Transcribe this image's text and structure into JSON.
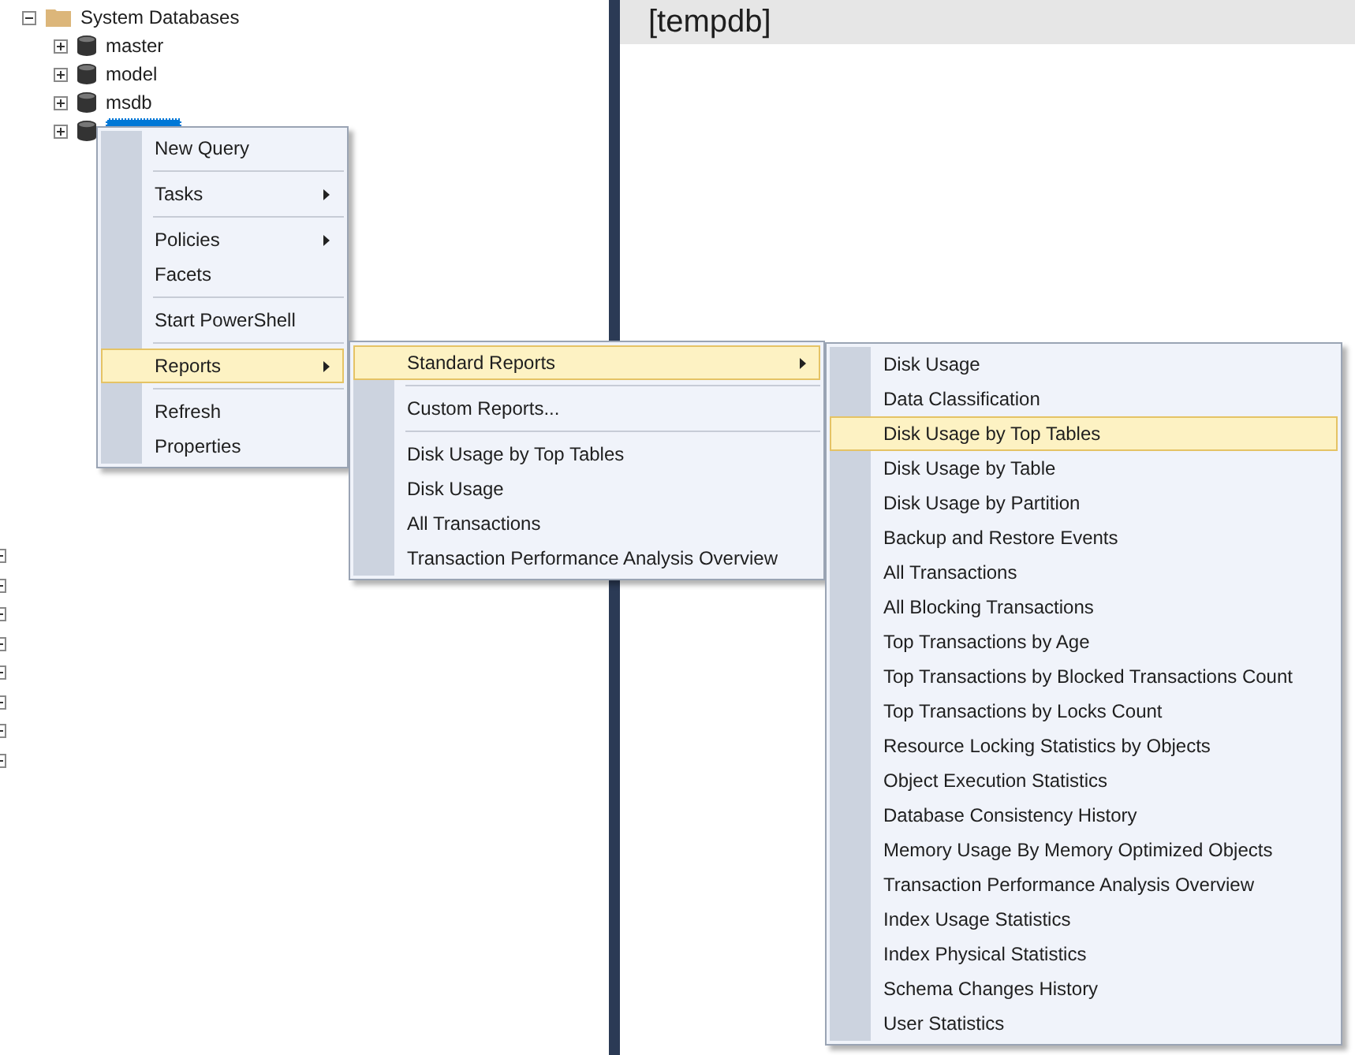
{
  "object_explorer": {
    "tree": {
      "label": "System Databases",
      "expanded": true,
      "children": [
        {
          "label": "master",
          "expanded": false,
          "selected": false
        },
        {
          "label": "model",
          "expanded": false,
          "selected": false
        },
        {
          "label": "msdb",
          "expanded": false,
          "selected": false
        },
        {
          "expanded": false,
          "selected": true
        }
      ]
    },
    "cut_off_rows": [
      {
        "kind": "expander"
      },
      {
        "kind": "expander"
      },
      {
        "kind": "expander"
      },
      {
        "kind": "expander"
      },
      {
        "kind": "expander"
      },
      {
        "kind": "expander"
      },
      {
        "kind": "expander"
      },
      {
        "kind": "expander"
      }
    ]
  },
  "document": {
    "title": "[tempdb]"
  },
  "context_menu": [
    {
      "kind": "item",
      "label": "New Query",
      "submenu": false,
      "selected": false
    },
    {
      "kind": "separator"
    },
    {
      "kind": "item",
      "label": "Tasks",
      "submenu": true,
      "selected": false
    },
    {
      "kind": "separator"
    },
    {
      "kind": "item",
      "label": "Policies",
      "submenu": true,
      "selected": false
    },
    {
      "kind": "item",
      "label": "Facets",
      "submenu": false,
      "selected": false
    },
    {
      "kind": "separator"
    },
    {
      "kind": "item",
      "label": "Start PowerShell",
      "submenu": false,
      "selected": false
    },
    {
      "kind": "separator"
    },
    {
      "kind": "item",
      "label": "Reports",
      "submenu": true,
      "selected": true
    },
    {
      "kind": "separator"
    },
    {
      "kind": "item",
      "label": "Refresh",
      "submenu": false,
      "selected": false
    },
    {
      "kind": "item",
      "label": "Properties",
      "submenu": false,
      "selected": false
    }
  ],
  "reports_menu": [
    {
      "kind": "item",
      "label": "Standard Reports",
      "submenu": true,
      "selected": true
    },
    {
      "kind": "separator"
    },
    {
      "kind": "item",
      "label": "Custom Reports...",
      "submenu": false,
      "selected": false
    },
    {
      "kind": "separator"
    },
    {
      "kind": "item",
      "label": "Disk Usage by Top Tables",
      "submenu": false,
      "selected": false
    },
    {
      "kind": "item",
      "label": "Disk Usage",
      "submenu": false,
      "selected": false
    },
    {
      "kind": "item",
      "label": "All Transactions",
      "submenu": false,
      "selected": false
    },
    {
      "kind": "item",
      "label": "Transaction Performance Analysis Overview",
      "submenu": false,
      "selected": false
    }
  ],
  "standard_reports_menu": [
    {
      "kind": "item",
      "label": "Disk Usage",
      "submenu": false,
      "selected": false
    },
    {
      "kind": "item",
      "label": "Data Classification",
      "submenu": false,
      "selected": false
    },
    {
      "kind": "item",
      "label": "Disk Usage by Top Tables",
      "submenu": false,
      "selected": true
    },
    {
      "kind": "item",
      "label": "Disk Usage by Table",
      "submenu": false,
      "selected": false
    },
    {
      "kind": "item",
      "label": "Disk Usage by Partition",
      "submenu": false,
      "selected": false
    },
    {
      "kind": "item",
      "label": "Backup and Restore Events",
      "submenu": false,
      "selected": false
    },
    {
      "kind": "item",
      "label": "All Transactions",
      "submenu": false,
      "selected": false
    },
    {
      "kind": "item",
      "label": "All Blocking Transactions",
      "submenu": false,
      "selected": false
    },
    {
      "kind": "item",
      "label": "Top Transactions by Age",
      "submenu": false,
      "selected": false
    },
    {
      "kind": "item",
      "label": "Top Transactions by Blocked Transactions Count",
      "submenu": false,
      "selected": false
    },
    {
      "kind": "item",
      "label": "Top Transactions by Locks Count",
      "submenu": false,
      "selected": false
    },
    {
      "kind": "item",
      "label": "Resource Locking Statistics by Objects",
      "submenu": false,
      "selected": false
    },
    {
      "kind": "item",
      "label": "Object Execution Statistics",
      "submenu": false,
      "selected": false
    },
    {
      "kind": "item",
      "label": "Database Consistency History",
      "submenu": false,
      "selected": false
    },
    {
      "kind": "item",
      "label": "Memory Usage By Memory Optimized Objects",
      "submenu": false,
      "selected": false
    },
    {
      "kind": "item",
      "label": "Transaction Performance Analysis Overview",
      "submenu": false,
      "selected": false
    },
    {
      "kind": "item",
      "label": "Index Usage Statistics",
      "submenu": false,
      "selected": false
    },
    {
      "kind": "item",
      "label": "Index Physical Statistics",
      "submenu": false,
      "selected": false
    },
    {
      "kind": "item",
      "label": "Schema Changes History",
      "submenu": false,
      "selected": false
    },
    {
      "kind": "item",
      "label": "User Statistics",
      "submenu": false,
      "selected": false
    }
  ]
}
